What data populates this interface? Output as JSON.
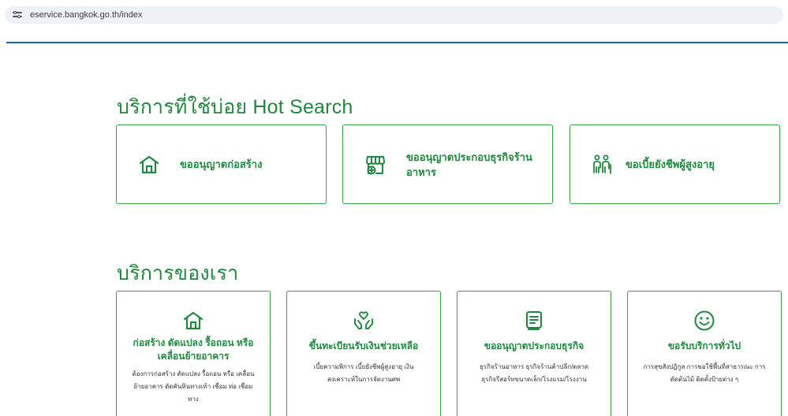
{
  "browser": {
    "url": "eservice.bangkok.go.th/index",
    "site_info_icon": "site-settings-icon"
  },
  "hot_search": {
    "title": "บริการที่ใช้บ่อย Hot Search",
    "cards": [
      {
        "icon": "house-icon",
        "label": "ขออนุญาตก่อสร้าง"
      },
      {
        "icon": "storefront-add-icon",
        "label": "ขออนุญาตประกอบธุรกิจร้าน อาหาร"
      },
      {
        "icon": "elderly-people-icon",
        "label": "ขอเบี้ยยังชีพผู้สูงอายุ"
      }
    ]
  },
  "our_services": {
    "title": "บริการของเรา",
    "cards": [
      {
        "icon": "house-icon",
        "title": "ก่อสร้าง ดัดแปลง รื้อถอน หรือเคลื่อนย้ายอาคาร",
        "desc": "ต้องการก่อสร้าง ดัดแปลง รื้อถอน หรือ เคลื่อนย้ายอาคาร ตัดคันหินทางเท้า เชื่อม ท่อ เชื่อมทาง"
      },
      {
        "icon": "hands-heart-icon",
        "title": "ขึ้นทะเบียนรับเงินช่วยเหลือ",
        "desc": "เบี้ยความพิการ เบี้ยยังชีพผู้สูงอายุ เงิน สงเคราะห์ในการจัดงานศพ"
      },
      {
        "icon": "document-icon",
        "title": "ขออนุญาตประกอบธุรกิจ",
        "desc": "ธุรกิจร้านอาหาร ธุรกิจร้านค้าปลีก/ตลาด ธุรกิจรีสอร์ทขนาดเล็ก/โรงแรม/โรงงาน"
      },
      {
        "icon": "smiley-icon",
        "title": "ขอรับบริการทั่วไป",
        "desc": "การสุขสังปฏิกูล การขอใช้พื้นที่สาธารณะ การตัดต้นไม้ ติดตั้งป้ายต่าง ๆ"
      }
    ]
  },
  "colors": {
    "accent": "#1f8a3d",
    "card_border": "#3aa14a",
    "header_line": "#1a63b6"
  }
}
